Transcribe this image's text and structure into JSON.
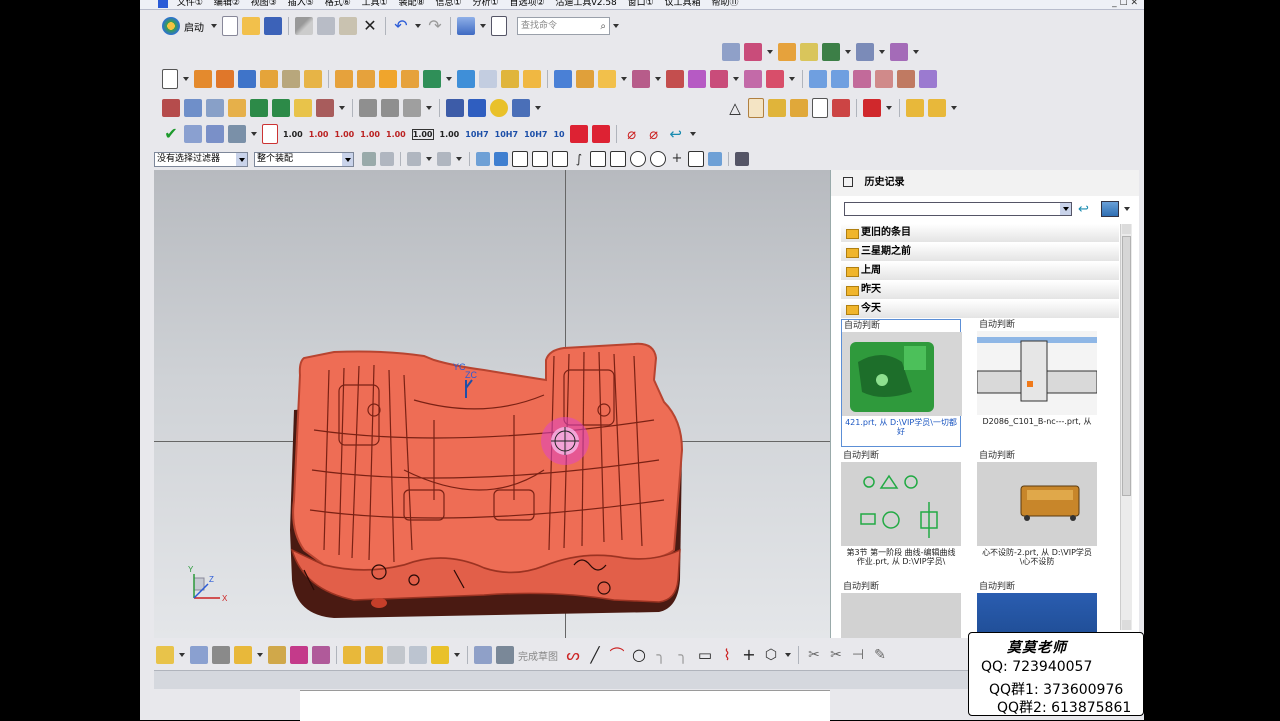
{
  "menu": {
    "items": [
      "文件①",
      "编辑②",
      "视图③",
      "插入⑤",
      "格式⑥",
      "工具①",
      "装配⑧",
      "信息①",
      "分析①",
      "首选项②",
      "沽迪工具v2.58",
      "窗口①",
      "议工具箱",
      "帮助⑪"
    ],
    "controls": "_ ☐ ✕"
  },
  "toolbar": {
    "start_label": "启动",
    "search_placeholder": "查找命令",
    "dims": [
      "1.00",
      "1.00",
      "1.00",
      "1.00",
      "1.00",
      "1.00",
      "1.00",
      "10H7",
      "10H7",
      "10H7",
      "10"
    ]
  },
  "filter": {
    "selection_filter": "没有选择过滤器",
    "scope": "整个装配"
  },
  "viewport": {
    "triad_labels": [
      "YC",
      "ZC"
    ],
    "axis_labels": [
      "X",
      "Y",
      "Z"
    ]
  },
  "history": {
    "title": "历史记录",
    "groups": [
      "更旧的条目",
      "三星期之前",
      "上周",
      "昨天",
      "今天"
    ],
    "cards": [
      {
        "label": "自动判断",
        "caption": "421.prt, 从 D:\\VIP学员\\一切都好",
        "selected": true
      },
      {
        "label": "自动判断",
        "caption": "D2086_C101_B-nc---.prt, 从",
        "selected": false
      },
      {
        "label": "自动判断",
        "caption": "第3节 第一阶段 曲线-编辑曲线作业.prt, 从 D:\\VIP学员\\",
        "selected": false
      },
      {
        "label": "自动判断",
        "caption": "心不设防-2.prt, 从 D:\\VIP学员\\心不设防",
        "selected": false
      },
      {
        "label": "自动判断",
        "caption": "",
        "selected": false
      },
      {
        "label": "自动判断",
        "caption": "",
        "selected": false
      }
    ]
  },
  "bottom_toolbar": {
    "finish_sketch": "完成草图"
  },
  "contact": {
    "name": "莫莫老师",
    "qq": "QQ: 723940057",
    "group1": "QQ群1: 373600976",
    "group2": "QQ群2: 613875861"
  },
  "colors": {
    "part": "#ee6d55",
    "part_dark": "#4a1a12",
    "accent_blue": "#2a5bd7",
    "selected_caption": "#1c57c2"
  }
}
